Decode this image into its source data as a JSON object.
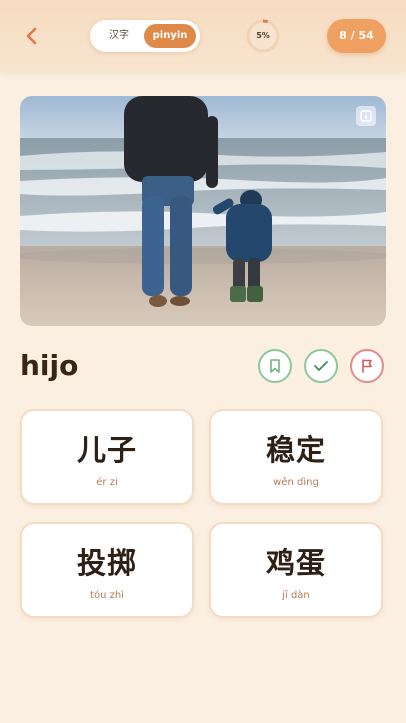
{
  "header": {
    "toggle_hanzi": "汉字",
    "toggle_pinyin": "pinyin",
    "active_toggle": "pinyin",
    "progress_label": "5%",
    "progress_fraction": 0.05,
    "counter": "8 / 54"
  },
  "word": "hijo",
  "choices": [
    {
      "hanzi": "儿子",
      "pinyin": "ér zi"
    },
    {
      "hanzi": "稳定",
      "pinyin": "wěn dìng"
    },
    {
      "hanzi": "投掷",
      "pinyin": "tóu zhì"
    },
    {
      "hanzi": "鸡蛋",
      "pinyin": "jī dàn"
    }
  ],
  "colors": {
    "accent": "#e08a4a",
    "background": "#fbefe1",
    "correct": "#8cc79e",
    "flag": "#e28b8b"
  },
  "icons": {
    "back": "chevron-left-icon",
    "info": "info-icon",
    "bookmark": "bookmark-icon",
    "check": "check-icon",
    "flag": "flag-icon"
  }
}
